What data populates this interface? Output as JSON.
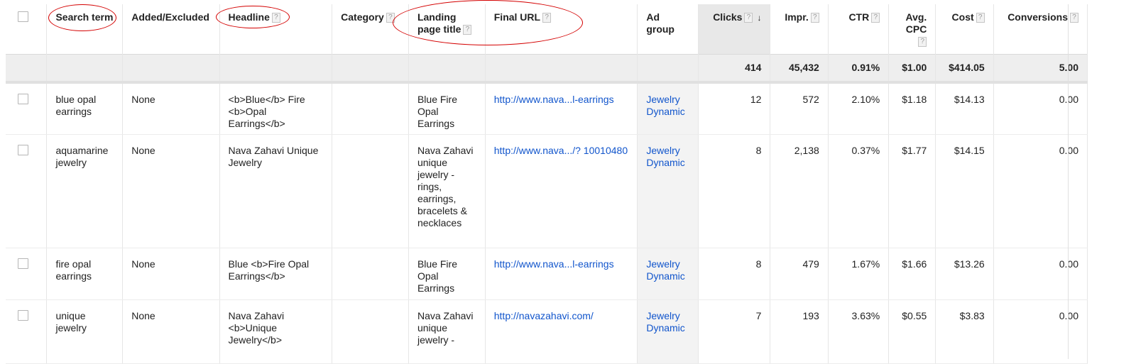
{
  "headers": {
    "search_term": "Search term",
    "added_excluded": "Added/Excluded",
    "headline": "Headline",
    "category": "Category",
    "landing_page_title": "Landing page title",
    "final_url": "Final URL",
    "ad_group": "Ad group",
    "clicks": "Clicks",
    "impr": "Impr.",
    "ctr": "CTR",
    "avg_cpc": "Avg. CPC",
    "cost": "Cost",
    "conversions": "Conversions",
    "help_glyph": "?",
    "sort_arrow": "↓"
  },
  "totals": {
    "clicks": "414",
    "impr": "45,432",
    "ctr": "0.91%",
    "avg_cpc": "$1.00",
    "cost": "$414.05",
    "conversions": "5.00"
  },
  "rows": [
    {
      "search_term": "blue opal earrings",
      "added_excluded": "None",
      "headline": "<b>Blue</b> Fire <b>Opal Earrings</b>",
      "category": "",
      "landing_page_title": "Blue Fire Opal Earrings",
      "final_url": "http://www.nava...l-earrings",
      "ad_group": "Jewelry Dynamic",
      "clicks": "12",
      "impr": "572",
      "ctr": "2.10%",
      "avg_cpc": "$1.18",
      "cost": "$14.13",
      "conversions": "0.00"
    },
    {
      "search_term": "aquamarine jewelry",
      "added_excluded": "None",
      "headline": "Nava Zahavi Unique Jewelry",
      "category": "",
      "landing_page_title": "Nava Zahavi unique jewelry - rings, earrings, bracelets & necklaces",
      "final_url": "http://www.nava.../? 10010480",
      "ad_group": "Jewelry Dynamic",
      "clicks": "8",
      "impr": "2,138",
      "ctr": "0.37%",
      "avg_cpc": "$1.77",
      "cost": "$14.15",
      "conversions": "0.00"
    },
    {
      "search_term": "fire opal earrings",
      "added_excluded": "None",
      "headline": "Blue <b>Fire Opal Earrings</b>",
      "category": "",
      "landing_page_title": "Blue Fire Opal Earrings",
      "final_url": "http://www.nava...l-earrings",
      "ad_group": "Jewelry Dynamic",
      "clicks": "8",
      "impr": "479",
      "ctr": "1.67%",
      "avg_cpc": "$1.66",
      "cost": "$13.26",
      "conversions": "0.00"
    },
    {
      "search_term": "unique jewelry",
      "added_excluded": "None",
      "headline": "Nava Zahavi <b>Unique Jewelry</b>",
      "category": "",
      "landing_page_title": "Nava Zahavi unique jewelry -",
      "final_url": "http://navazahavi.com/",
      "ad_group": "Jewelry Dynamic",
      "clicks": "7",
      "impr": "193",
      "ctr": "3.63%",
      "avg_cpc": "$0.55",
      "cost": "$3.83",
      "conversions": "0.00"
    }
  ],
  "colors": {
    "link": "#1155cc",
    "annotation": "#d40000",
    "total_row_bg": "#eeeeee"
  }
}
